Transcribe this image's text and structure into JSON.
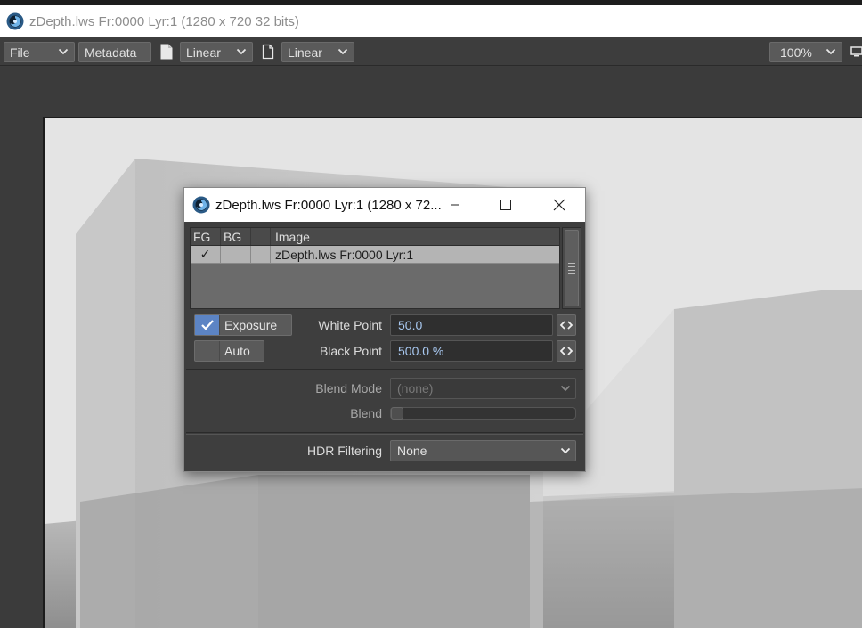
{
  "window": {
    "title": "zDepth.lws Fr:0000 Lyr:1 (1280 x 720 32 bits)",
    "app_icon": "lightwave-swirl-icon"
  },
  "toolbar": {
    "file_label": "File",
    "metadata_label": "Metadata",
    "fg_colorspace": "Linear",
    "bg_colorspace": "Linear",
    "zoom": "100%"
  },
  "dialog": {
    "title": "zDepth.lws Fr:0000 Lyr:1 (1280 x 72...",
    "columns": {
      "fg": "FG",
      "bg": "BG",
      "image": "Image"
    },
    "rows": [
      {
        "fg": "✓",
        "bg": "",
        "image": "zDepth.lws Fr:0000 Lyr:1"
      }
    ],
    "exposure_label": "Exposure",
    "exposure_checked": true,
    "auto_label": "Auto",
    "auto_checked": false,
    "white_point_label": "White Point",
    "white_point_value": "50.0",
    "black_point_label": "Black Point",
    "black_point_value": "500.0 %",
    "blend_mode_label": "Blend Mode",
    "blend_mode_value": "(none)",
    "blend_label": "Blend",
    "blend_level": 0,
    "hdr_filtering_label": "HDR Filtering",
    "hdr_filtering_value": "None"
  },
  "colors": {
    "accent": "#5c84c4",
    "field_text": "#a8c8f0"
  }
}
